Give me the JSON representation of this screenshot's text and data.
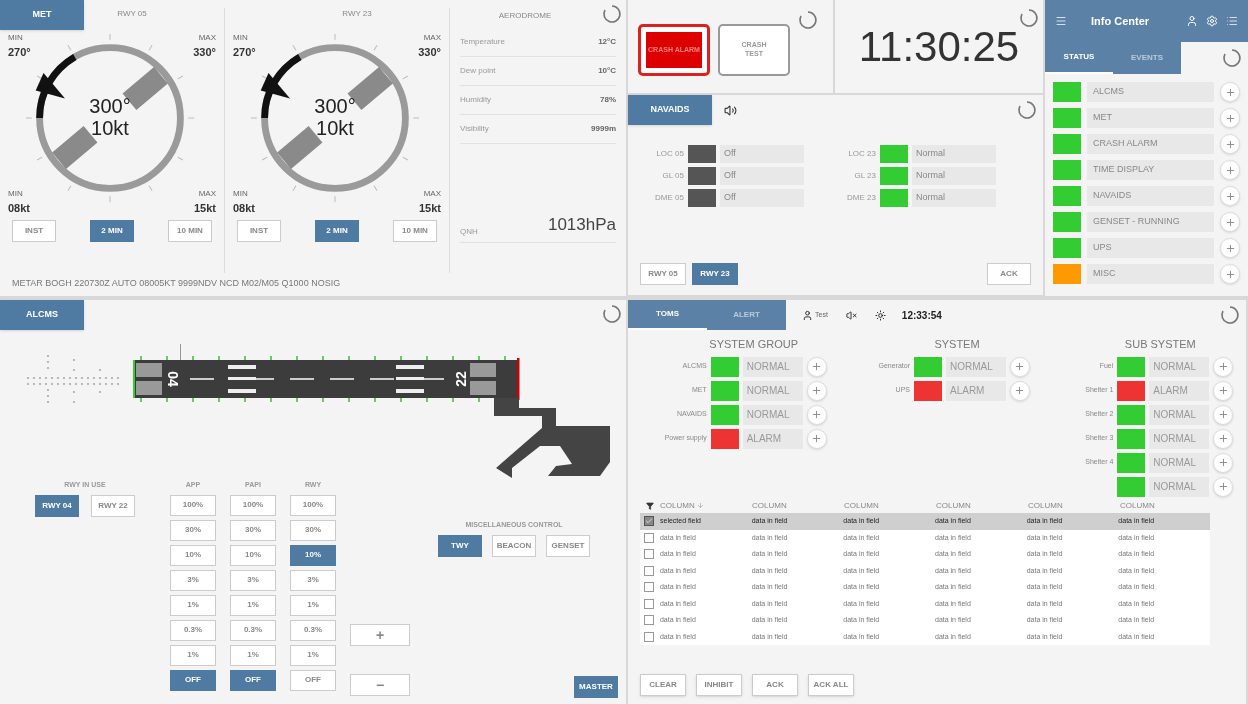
{
  "met": {
    "tab": "MET",
    "runways": [
      {
        "title": "RWY 05",
        "min_dir_label": "MIN",
        "min_dir": "270°",
        "max_dir_label": "MAX",
        "max_dir": "330°",
        "direction": "300°",
        "speed": "10kt",
        "min_speed_label": "MIN",
        "min_speed": "08kt",
        "max_speed_label": "MAX",
        "max_speed": "15kt",
        "modes": [
          {
            "label": "INST",
            "selected": false
          },
          {
            "label": "2 MIN",
            "selected": true
          },
          {
            "label": "10 MIN",
            "selected": false
          }
        ]
      },
      {
        "title": "RWY 23",
        "min_dir_label": "MIN",
        "min_dir": "270°",
        "max_dir_label": "MAX",
        "max_dir": "330°",
        "direction": "300°",
        "speed": "10kt",
        "min_speed_label": "MIN",
        "min_speed": "08kt",
        "max_speed_label": "MAX",
        "max_speed": "15kt",
        "modes": [
          {
            "label": "INST",
            "selected": false
          },
          {
            "label": "2 MIN",
            "selected": true
          },
          {
            "label": "10 MIN",
            "selected": false
          }
        ]
      }
    ],
    "aerodrome": {
      "title": "AERODROME",
      "rows": [
        {
          "label": "Temperature",
          "value": "12°C"
        },
        {
          "label": "Dew point",
          "value": "10°C"
        },
        {
          "label": "Humidity",
          "value": "78%"
        },
        {
          "label": "Visibility",
          "value": "9999m"
        }
      ],
      "qnh": {
        "label": "QNH",
        "value": "1013hPa"
      }
    },
    "metar": "METAR BOGH 220730Z AUTO 08005KT 9999NDV NCD M02/M05 Q1000 NOSIG"
  },
  "crash": {
    "buttons": [
      {
        "kind": "alarm",
        "label": "CRASH ALARM"
      },
      {
        "kind": "test",
        "label": "CRASH TEST"
      }
    ]
  },
  "clock": "11:30:25",
  "navaids": {
    "tab": "NAVAIDS",
    "groups": [
      [
        {
          "label": "LOC 05",
          "status": "Off",
          "color": "#555555"
        },
        {
          "label": "GL 05",
          "status": "Off",
          "color": "#555555"
        },
        {
          "label": "DME 05",
          "status": "Off",
          "color": "#555555"
        }
      ],
      [
        {
          "label": "LOC 23",
          "status": "Normal",
          "color": "#33cc33"
        },
        {
          "label": "GL 23",
          "status": "Normal",
          "color": "#33cc33"
        },
        {
          "label": "DME 23",
          "status": "Normal",
          "color": "#33cc33"
        }
      ]
    ],
    "runways": [
      {
        "label": "RWY 05",
        "selected": false
      },
      {
        "label": "RWY 23",
        "selected": true
      }
    ],
    "ack": "ACK"
  },
  "info_center": {
    "title": "Info Center",
    "tabs": [
      {
        "label": "STATUS",
        "selected": true
      },
      {
        "label": "EVENTS",
        "selected": false
      }
    ],
    "items": [
      {
        "label": "ALCMS",
        "color": "#33cc33"
      },
      {
        "label": "MET",
        "color": "#33cc33"
      },
      {
        "label": "CRASH ALARM",
        "color": "#33cc33"
      },
      {
        "label": "TIME DISPLAY",
        "color": "#33cc33"
      },
      {
        "label": "NAVAIDS",
        "color": "#33cc33"
      },
      {
        "label": "GENSET - RUNNING",
        "color": "#33cc33"
      },
      {
        "label": "UPS",
        "color": "#33cc33"
      },
      {
        "label": "MISC",
        "color": "#ff9900"
      }
    ]
  },
  "alcms": {
    "tab": "ALCMS",
    "runway_ends": [
      "04",
      "22"
    ],
    "rwy_in_use": {
      "title": "RWY IN USE",
      "options": [
        {
          "label": "RWY 04",
          "selected": true
        },
        {
          "label": "RWY 22",
          "selected": false
        }
      ]
    },
    "columns": [
      {
        "title": "APP",
        "steps": [
          {
            "label": "100%",
            "selected": false
          },
          {
            "label": "30%",
            "selected": false
          },
          {
            "label": "10%",
            "selected": false
          },
          {
            "label": "3%",
            "selected": false
          },
          {
            "label": "1%",
            "selected": false
          },
          {
            "label": "0.3%",
            "selected": false
          },
          {
            "label": "1%",
            "selected": false
          },
          {
            "label": "OFF",
            "selected": true
          }
        ]
      },
      {
        "title": "PAPI",
        "steps": [
          {
            "label": "100%",
            "selected": false
          },
          {
            "label": "30%",
            "selected": false
          },
          {
            "label": "10%",
            "selected": false
          },
          {
            "label": "3%",
            "selected": false
          },
          {
            "label": "1%",
            "selected": false
          },
          {
            "label": "0.3%",
            "selected": false
          },
          {
            "label": "1%",
            "selected": false
          },
          {
            "label": "OFF",
            "selected": true
          }
        ]
      },
      {
        "title": "RWY",
        "steps": [
          {
            "label": "100%",
            "selected": false
          },
          {
            "label": "30%",
            "selected": false
          },
          {
            "label": "10%",
            "selected": true
          },
          {
            "label": "3%",
            "selected": false
          },
          {
            "label": "1%",
            "selected": false
          },
          {
            "label": "0.3%",
            "selected": false
          },
          {
            "label": "1%",
            "selected": false
          },
          {
            "label": "OFF",
            "selected": false
          }
        ]
      }
    ],
    "adjust": [
      "+",
      "−"
    ],
    "misc": {
      "title": "MISCELLANEOUS CONTROL",
      "options": [
        {
          "label": "TWY",
          "selected": true
        },
        {
          "label": "BEACON",
          "selected": false
        },
        {
          "label": "GENSET",
          "selected": false
        }
      ]
    },
    "master": "MASTER"
  },
  "toms": {
    "tabs": [
      {
        "label": "TOMS",
        "selected": true
      },
      {
        "label": "ALERT",
        "selected": false
      }
    ],
    "user": "Test",
    "time": "12:33:54",
    "sections": [
      {
        "title": "SYSTEM GROUP",
        "rows": [
          {
            "label": "ALCMS",
            "status": "NORMAL",
            "color": "#33cc33"
          },
          {
            "label": "MET",
            "status": "NORMAL",
            "color": "#33cc33"
          },
          {
            "label": "NAVAIDS",
            "status": "NORMAL",
            "color": "#33cc33"
          },
          {
            "label": "Power supply",
            "status": "ALARM",
            "color": "#ee3333"
          }
        ]
      },
      {
        "title": "SYSTEM",
        "rows": [
          {
            "label": "Generator",
            "status": "NORMAL",
            "color": "#33cc33"
          },
          {
            "label": "UPS",
            "status": "ALARM",
            "color": "#ee3333"
          }
        ]
      },
      {
        "title": "SUB SYSTEM",
        "rows": [
          {
            "label": "Fuel",
            "status": "NORMAL",
            "color": "#33cc33"
          },
          {
            "label": "Shelter 1",
            "status": "ALARM",
            "color": "#ee3333"
          },
          {
            "label": "Shelter 2",
            "status": "NORMAL",
            "color": "#33cc33"
          },
          {
            "label": "Shelter 3",
            "status": "NORMAL",
            "color": "#33cc33"
          },
          {
            "label": "Shelter 4",
            "status": "NORMAL",
            "color": "#33cc33"
          },
          {
            "status": "NORMAL",
            "color": "#33cc33"
          }
        ]
      }
    ],
    "table": {
      "columns": [
        "COLUMN",
        "COLUMN",
        "COLUMN",
        "COLUMN",
        "COLUMN",
        "COLUMN"
      ],
      "rows": [
        {
          "selected": true,
          "cells": [
            "selected field",
            "data in field",
            "data in field",
            "data in field",
            "data in field",
            "data in field"
          ]
        },
        {
          "selected": false,
          "cells": [
            "data in field",
            "data in field",
            "data in field",
            "data in field",
            "data in field",
            "data in field"
          ]
        },
        {
          "selected": false,
          "cells": [
            "data in field",
            "data in field",
            "data in field",
            "data in field",
            "data in field",
            "data in field"
          ]
        },
        {
          "selected": false,
          "cells": [
            "data in field",
            "data in field",
            "data in field",
            "data in field",
            "data in field",
            "data in field"
          ]
        },
        {
          "selected": false,
          "cells": [
            "data in field",
            "data in field",
            "data in field",
            "data in field",
            "data in field",
            "data in field"
          ]
        },
        {
          "selected": false,
          "cells": [
            "data in field",
            "data in field",
            "data in field",
            "data in field",
            "data in field",
            "data in field"
          ]
        },
        {
          "selected": false,
          "cells": [
            "data in field",
            "data in field",
            "data in field",
            "data in field",
            "data in field",
            "data in field"
          ]
        },
        {
          "selected": false,
          "cells": [
            "data in field",
            "data in field",
            "data in field",
            "data in field",
            "data in field",
            "data in field"
          ]
        }
      ]
    },
    "buttons": [
      "CLEAR",
      "INHIBIT",
      "ACK",
      "ACK ALL"
    ]
  }
}
